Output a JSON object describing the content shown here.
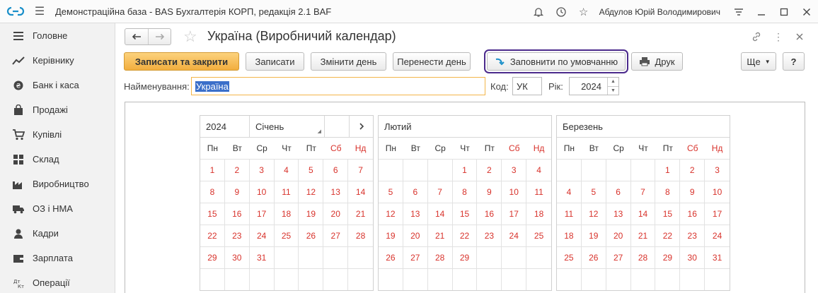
{
  "app": {
    "title": "Демонстраційна база - BAS Бухгалтерія КОРП, редакція 2.1 BAF",
    "user": "Абдулов Юрій Володимирович"
  },
  "sidebar": {
    "items": [
      {
        "label": "Головне",
        "icon": "menu-lines-icon"
      },
      {
        "label": "Керівнику",
        "icon": "trend-chart-icon"
      },
      {
        "label": "Банк і каса",
        "icon": "coins-icon"
      },
      {
        "label": "Продажі",
        "icon": "shopping-bag-icon"
      },
      {
        "label": "Купівлі",
        "icon": "cart-icon"
      },
      {
        "label": "Склад",
        "icon": "warehouse-icon"
      },
      {
        "label": "Виробництво",
        "icon": "factory-icon"
      },
      {
        "label": "ОЗ і НМА",
        "icon": "truck-icon"
      },
      {
        "label": "Кадри",
        "icon": "person-icon"
      },
      {
        "label": "Зарплата",
        "icon": "wallet-icon"
      },
      {
        "label": "Операції",
        "icon": "debit-credit-icon"
      }
    ]
  },
  "document": {
    "title": "Україна (Виробничий календар)"
  },
  "toolbar": {
    "save_close": "Записати та закрити",
    "save": "Записати",
    "change_day": "Змінити день",
    "move_day": "Перенести день",
    "fill_default": "Заповнити по умовчанню",
    "print": "Друк",
    "more": "Ще",
    "help": "?"
  },
  "form": {
    "name_label": "Найменування:",
    "name_value": "Україна",
    "code_label": "Код:",
    "code_value": "УК",
    "year_label": "Рік:",
    "year_value": "2024"
  },
  "calendar": {
    "year": "2024",
    "weekdays": [
      "Пн",
      "Вт",
      "Ср",
      "Чт",
      "Пт",
      "Сб",
      "Нд"
    ],
    "next_icon": "chevron-right-icon",
    "months": [
      {
        "name": "Січень",
        "offset": 0,
        "days": 31
      },
      {
        "name": "Лютий",
        "offset": 3,
        "days": 29
      },
      {
        "name": "Березень",
        "offset": 4,
        "days": 31
      }
    ]
  },
  "colors": {
    "accent_orange": "#f2ae3e",
    "day_red": "#d8322b",
    "highlight_purple": "#4b2a8c",
    "selection_blue": "#3b6fc9"
  }
}
